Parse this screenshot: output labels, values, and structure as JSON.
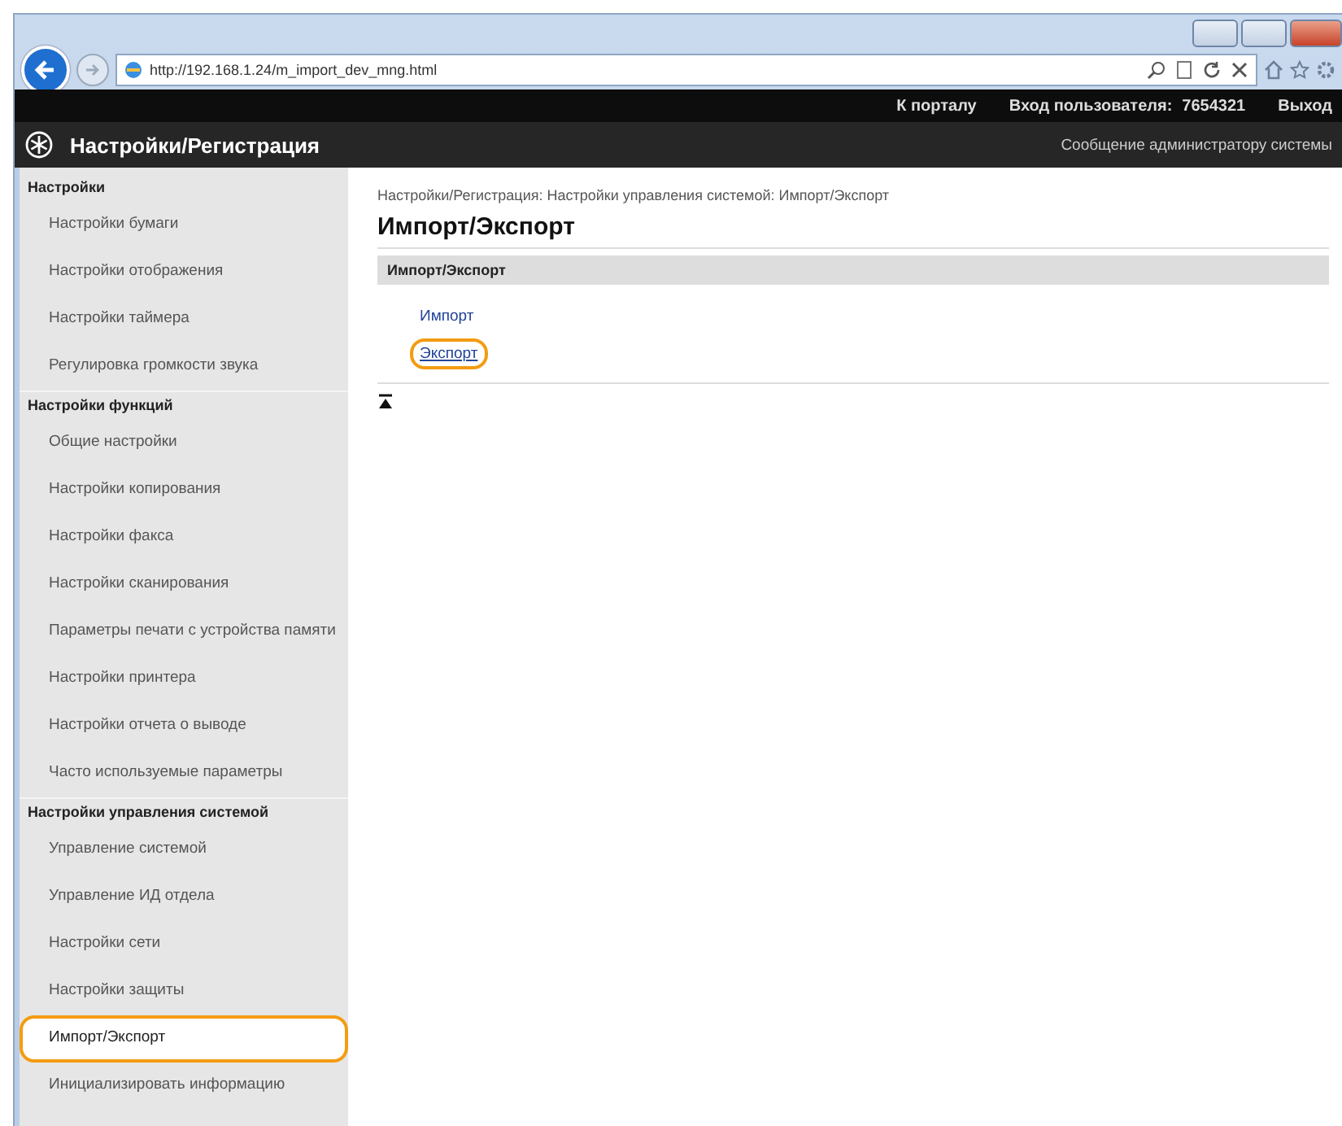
{
  "browser": {
    "address": "http://192.168.1.24/m_import_dev_mng.html"
  },
  "top_bar": {
    "links": [
      "К порталу",
      "Вход пользователя:",
      "7654321",
      "Выход"
    ]
  },
  "header": {
    "title": "Настройки/Регистрация",
    "message_link": "Сообщение администратору системы"
  },
  "sidebar": {
    "groups": [
      {
        "title": "Настройки",
        "items": [
          {
            "label": "Настройки бумаги",
            "selected": false,
            "highlighted": false
          },
          {
            "label": "Настройки отображения",
            "selected": false,
            "highlighted": false
          },
          {
            "label": "Настройки таймера",
            "selected": false,
            "highlighted": false
          },
          {
            "label": "Регулировка громкости звука",
            "selected": false,
            "highlighted": false
          }
        ]
      },
      {
        "title": "Настройки функций",
        "items": [
          {
            "label": "Общие настройки",
            "selected": false,
            "highlighted": false
          },
          {
            "label": "Настройки копирования",
            "selected": false,
            "highlighted": false
          },
          {
            "label": "Настройки факса",
            "selected": false,
            "highlighted": false
          },
          {
            "label": "Настройки сканирования",
            "selected": false,
            "highlighted": false
          },
          {
            "label": "Параметры печати с устройства памяти",
            "selected": false,
            "highlighted": false
          },
          {
            "label": "Настройки принтера",
            "selected": false,
            "highlighted": false
          },
          {
            "label": "Настройки отчета о выводе",
            "selected": false,
            "highlighted": false
          },
          {
            "label": "Часто используемые параметры",
            "selected": false,
            "highlighted": false
          }
        ]
      },
      {
        "title": "Настройки управления системой",
        "items": [
          {
            "label": "Управление системой",
            "selected": false,
            "highlighted": false
          },
          {
            "label": "Управление ИД отдела",
            "selected": false,
            "highlighted": false
          },
          {
            "label": "Настройки сети",
            "selected": false,
            "highlighted": false
          },
          {
            "label": "Настройки защиты",
            "selected": false,
            "highlighted": false
          },
          {
            "label": "Импорт/Экспорт",
            "selected": true,
            "highlighted": true
          },
          {
            "label": "Инициализировать информацию",
            "selected": false,
            "highlighted": false
          }
        ]
      }
    ]
  },
  "content": {
    "breadcrumb": "Настройки/Регистрация: Настройки управления системой: Импорт/Экспорт",
    "title": "Импорт/Экспорт",
    "section": {
      "title": "Импорт/Экспорт",
      "links": [
        {
          "label": "Импорт",
          "highlighted": false
        },
        {
          "label": "Экспорт",
          "highlighted": true
        }
      ]
    }
  }
}
